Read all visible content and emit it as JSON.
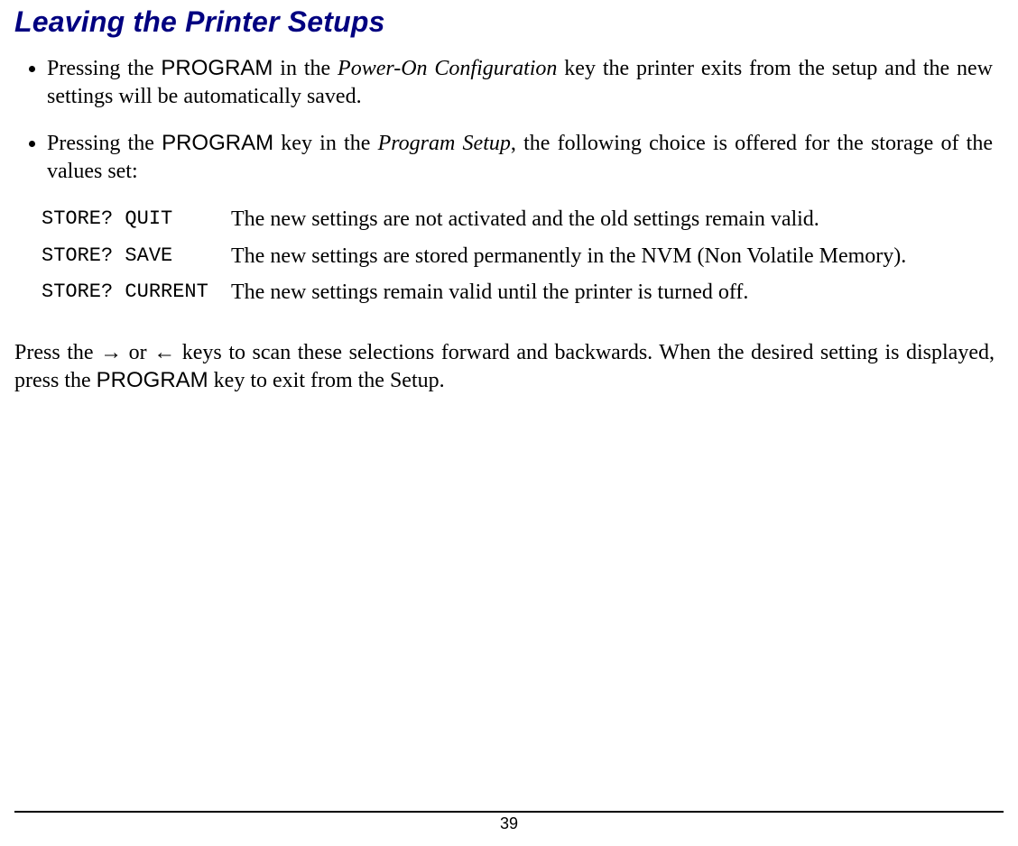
{
  "title": "Leaving the Printer Setups",
  "bullets": {
    "b1": {
      "pre": "Pressing the ",
      "key": "PROGRAM",
      "mid": " in the ",
      "ital": "Power-On Configuration",
      "post": " key the printer exits from the setup and the new settings will be automatically saved."
    },
    "b2": {
      "pre": "Pressing the ",
      "key": "PROGRAM",
      "mid": " key in the ",
      "ital": "Program Setup",
      "post": ", the following choice is offered for the storage of the values set:"
    }
  },
  "store": {
    "rows": [
      {
        "label": "STORE? QUIT",
        "desc": "The new settings are not activated and the old settings remain valid."
      },
      {
        "label": "STORE? SAVE",
        "desc": "The new settings are stored permanently in the NVM (Non Volatile Memory)."
      },
      {
        "label": "STORE? CURRENT",
        "desc": "The new settings remain valid until the printer is turned off."
      }
    ]
  },
  "closing": {
    "pre": "Press the → or ← keys to scan these selections forward and backwards. When the desired setting is displayed, press the ",
    "key": "PROGRAM",
    "post": " key to exit from the Setup."
  },
  "page_number": "39"
}
